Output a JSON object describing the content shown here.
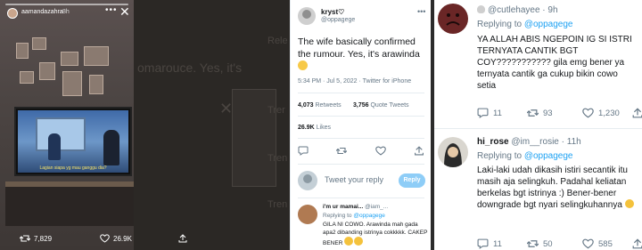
{
  "story": {
    "username": "aamandazahra",
    "time": "8h",
    "tv_caption": "Lagian siapa yg mau ganggu dia?",
    "retweets": "7,829",
    "likes": "26.9K"
  },
  "background_ghost": {
    "line1": "Rele",
    "line2": "omarouce. Yes, it's",
    "line3": "Trer",
    "line4": "Tren",
    "line5": "Tren"
  },
  "tweet": {
    "display_name": "kryst♡",
    "handle": "@oppagege",
    "text": "The wife basically confirmed the rumour. Yes, it's arawinda",
    "time": "5:34 PM · Jul 5, 2022 · Twitter for iPhone",
    "retweets_count": "4,073",
    "retweets_label": "Retweets",
    "quote_count": "3,756",
    "quote_label": "Quote Tweets",
    "likes_count": "26.9K",
    "likes_label": "Likes",
    "reply_placeholder": "Tweet your reply",
    "reply_button": "Reply",
    "comment": {
      "name": "i'm ur mamai...",
      "handle": "@iam_...",
      "replying_to_label": "Replying to",
      "replying_to_handle": "@oppagege",
      "text": "GILA NI COWO. Arawinda mah gada apa2 dibanding istrinya cokkkkk. CAKEP BENER"
    }
  },
  "replies": [
    {
      "handle": "@cutlehayee · 9h",
      "replying_to_label": "Replying to",
      "replying_to_handle": "@oppagege",
      "text": "YA ALLAH ABIS NGEPOIN IG SI ISTRI TERNYATA CANTIK BGT COY??????????? gila emg bener ya ternyata cantik ga cukup bikin cowo setia",
      "replies": "11",
      "retweets": "93",
      "likes": "1,230"
    },
    {
      "name": "hi_rose",
      "handle": "@im__rosie · 11h",
      "replying_to_label": "Replying to",
      "replying_to_handle": "@oppagege",
      "text": "Laki-laki udah dikasih istiri secantik itu masih aja selingkuh. Padahal keliatan berkelas bgt istrinya :) Bener-bener downgrade bgt nyari selingkuhannya",
      "replies": "11",
      "retweets": "50",
      "likes": "585"
    }
  ]
}
